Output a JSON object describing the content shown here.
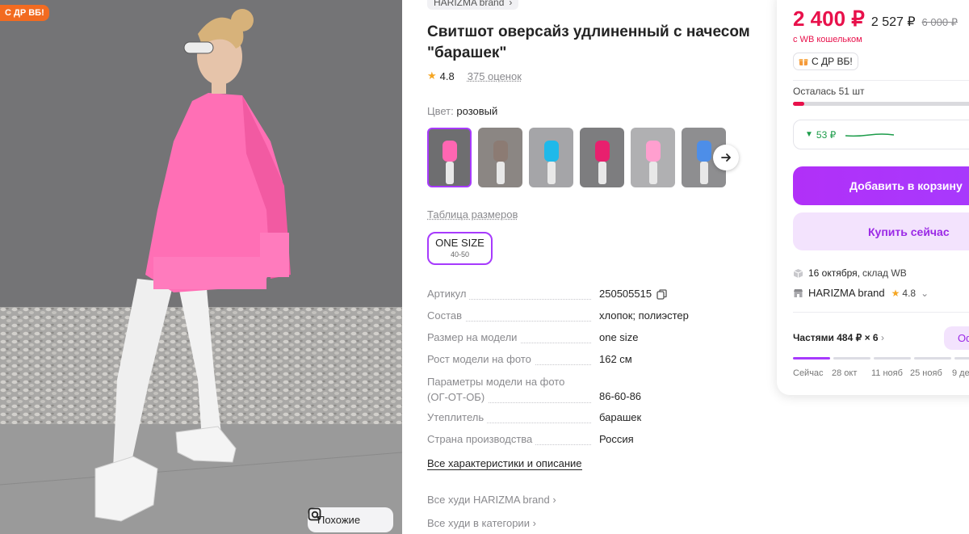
{
  "photo": {
    "promo_badge": "С ДР ВБ!",
    "similar_label": "Похожие"
  },
  "product": {
    "brand": "HARIZMA brand",
    "title": "Свитшот оверсайз удлиненный с начесом \"барашек\"",
    "rating": "4.8",
    "reviews": "375 оценок",
    "color_label": "Цвет:",
    "color_value": "розовый",
    "swatch_colors": [
      "#ff66b2",
      "#8c7b73",
      "#1fb9ea",
      "#e8206e",
      "#ff9fcf",
      "#4d8ee8"
    ],
    "size_table_link": "Таблица размеров",
    "size": {
      "label": "ONE SIZE",
      "range": "40-50"
    },
    "specs": [
      {
        "key": "Артикул",
        "value": "250505515"
      },
      {
        "key": "Состав",
        "value": "хлопок; полиэстер"
      },
      {
        "key": "Размер на модели",
        "value": "one size"
      },
      {
        "key": "Рост модели на фото",
        "value": "162 см"
      },
      {
        "key": "Параметры модели на фото (ОГ-ОТ-ОБ)",
        "value": "86-60-86"
      },
      {
        "key": "Утеплитель",
        "value": "барашек"
      },
      {
        "key": "Страна производства",
        "value": "Россия"
      }
    ],
    "all_specs_link": "Все характеристики и описание",
    "category_links": [
      "Все худи HARIZMA brand",
      "Все худи в категории"
    ]
  },
  "card": {
    "price": "2 400 ₽",
    "price_old": "2 527 ₽",
    "price_original": "6 000 ₽",
    "wallet_note": "с WB кошельком",
    "promo_tag": "С ДР ВБ!",
    "stock_text": "Осталась 51 шт",
    "stock_fraction": 0.06,
    "price_drop": "53 ₽",
    "add_to_cart": "Добавить в корзину",
    "buy_now": "Купить сейчас",
    "delivery_date": "16 октября,",
    "delivery_place": "склад WB",
    "seller_name": "HARIZMA brand",
    "seller_rating": "4.8",
    "installments": "Частями 484 ₽ × 6",
    "installments_btn": "Оф",
    "schedule": [
      "Сейчас",
      "28 окт",
      "11 нояб",
      "25 нояб",
      "9 де"
    ],
    "accent": "#a73afd",
    "price_color": "#e8114b"
  }
}
